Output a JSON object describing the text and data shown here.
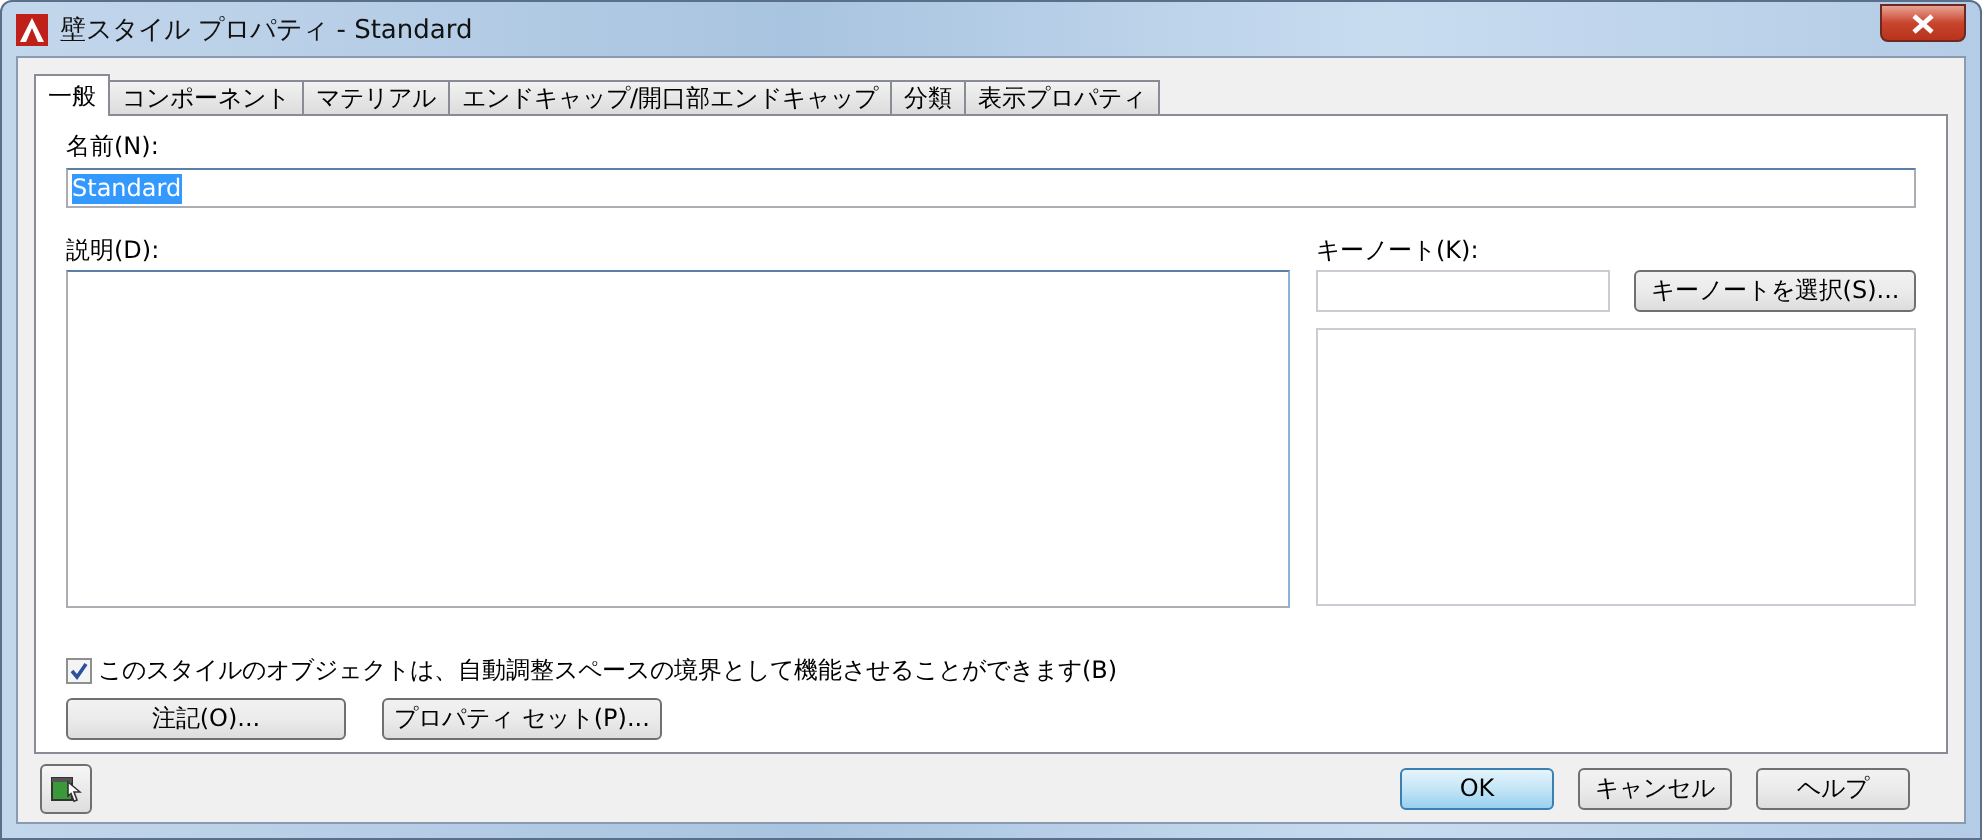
{
  "window": {
    "title": "壁スタイル プロパティ - Standard"
  },
  "tabs": [
    {
      "label": "一般",
      "selected": true
    },
    {
      "label": "コンポーネント",
      "selected": false
    },
    {
      "label": "マテリアル",
      "selected": false
    },
    {
      "label": "エンドキャップ/開口部エンドキャップ",
      "selected": false
    },
    {
      "label": "分類",
      "selected": false
    },
    {
      "label": "表示プロパティ",
      "selected": false
    }
  ],
  "name_field": {
    "label": "名前(N):",
    "value": "Standard",
    "highlighted": true
  },
  "description": {
    "label": "説明(D):"
  },
  "keynote": {
    "label": "キーノート(K):",
    "button": "キーノートを選択(S)..."
  },
  "option": {
    "label": "このスタイルのオブジェクトは、自動調整スペースの境界として機能させることができます(B)",
    "checked": true
  },
  "buttons": [
    "注記(O)...",
    "プロパティ セット(P)..."
  ],
  "footer_buttons": [
    {
      "label": "OK",
      "default": true
    },
    {
      "label": "キャンセル",
      "default": false
    },
    {
      "label": "ヘルプ",
      "default": false
    }
  ]
}
